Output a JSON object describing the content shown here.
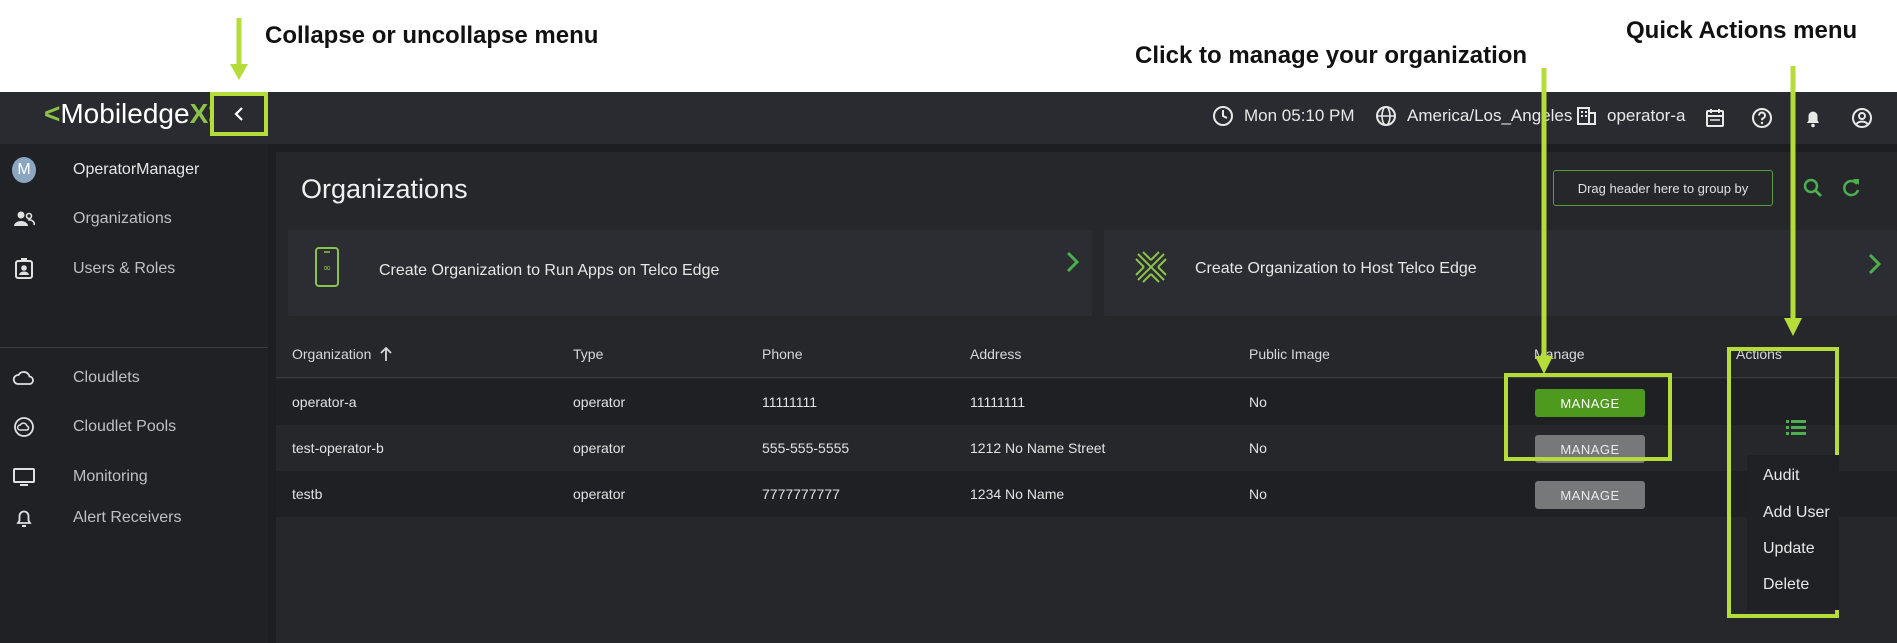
{
  "annotations": {
    "collapse": "Collapse or uncollapse menu",
    "manage_org": "Click to manage your organization",
    "quick_actions": "Quick Actions menu"
  },
  "brand": {
    "logo_left": "<",
    "logo_text": "Mobiledge",
    "logo_right": "X>",
    "accent": "#8bc34a",
    "highlight": "#b5dd3a"
  },
  "topbar": {
    "time": "Mon 05:10 PM",
    "timezone": "America/Los_Angeles",
    "organization": "operator-a",
    "icons": [
      "clock-icon",
      "globe-icon",
      "building-icon",
      "calendar-icon",
      "help-icon",
      "bell-icon",
      "account-icon"
    ]
  },
  "sidebar": {
    "user": {
      "initial": "M",
      "role": "OperatorManager"
    },
    "items": [
      {
        "label": "Organizations",
        "icon": "organizations-icon"
      },
      {
        "label": "Users & Roles",
        "icon": "users-roles-icon"
      },
      {
        "label": "Cloudlets",
        "icon": "cloud-icon"
      },
      {
        "label": "Cloudlet Pools",
        "icon": "cloudlet-pools-icon"
      },
      {
        "label": "Monitoring",
        "icon": "monitor-icon"
      },
      {
        "label": "Alert Receivers",
        "icon": "alert-bell-icon"
      }
    ]
  },
  "main": {
    "title": "Organizations",
    "group_by": "Drag header here to group by",
    "cards": [
      {
        "label": "Create Organization to Run Apps on Telco Edge"
      },
      {
        "label": "Create Organization to Host Telco Edge"
      }
    ],
    "columns": [
      "Organization",
      "Type",
      "Phone",
      "Address",
      "Public Image",
      "Manage",
      "Actions"
    ],
    "rows": [
      {
        "organization": "operator-a",
        "type": "operator",
        "phone": "11111111",
        "address": "11111111",
        "public_image": "No",
        "manage": "MANAGE"
      },
      {
        "organization": "test-operator-b",
        "type": "operator",
        "phone": "555-555-5555",
        "address": "1212 No Name Street",
        "public_image": "No",
        "manage": "MANAGE"
      },
      {
        "organization": "testb",
        "type": "operator",
        "phone": "7777777777",
        "address": "1234 No Name",
        "public_image": "No",
        "manage": "MANAGE"
      }
    ]
  },
  "actions_menu": [
    "Audit",
    "Add User",
    "Update",
    "Delete"
  ]
}
